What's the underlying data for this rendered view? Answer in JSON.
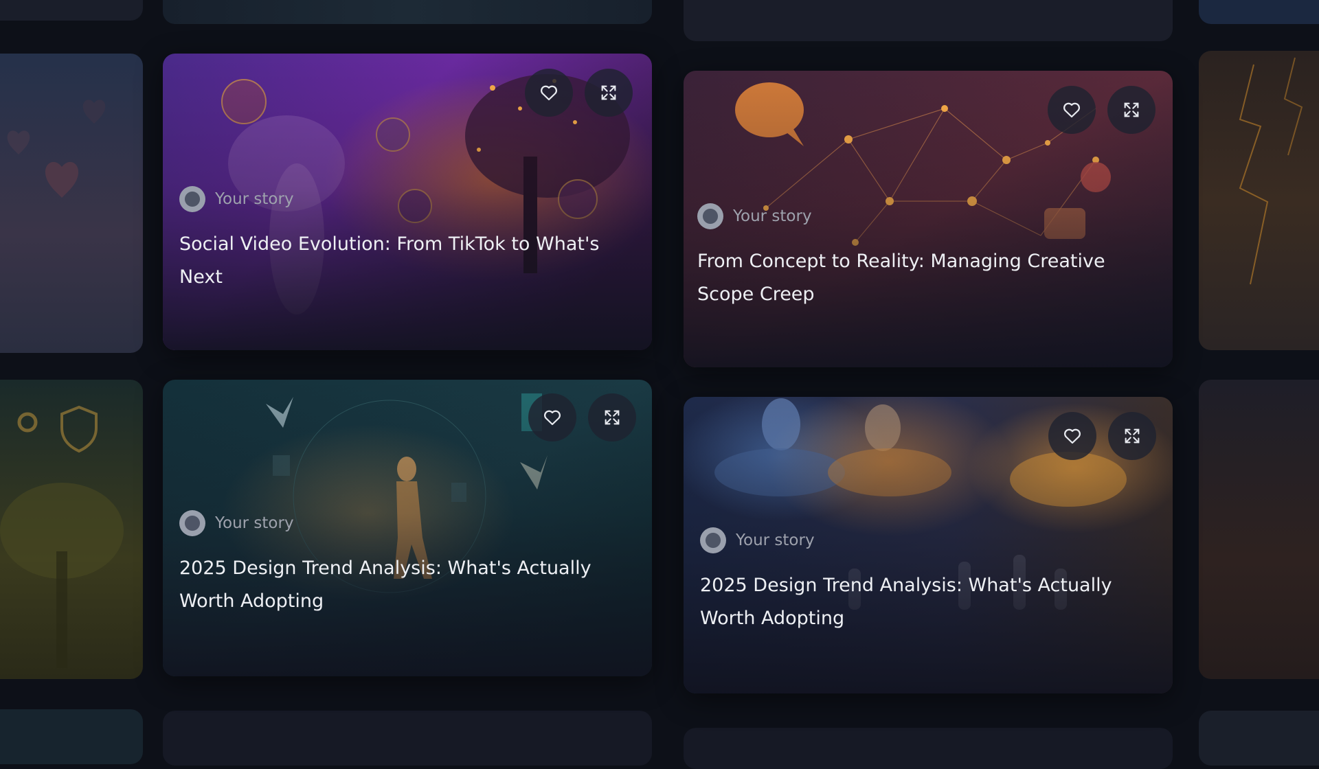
{
  "cards": [
    {
      "author": "Your story",
      "title": "Social Video Evolution: From TikTok to What's Next",
      "accent": "#7a3fbf"
    },
    {
      "author": "Your story",
      "title": "From Concept to Reality: Managing Creative Scope Creep",
      "accent": "#c86a2a"
    },
    {
      "author": "Your story",
      "title": "2025 Design Trend Analysis: What's Actually Worth Adopting",
      "accent": "#1f5a6a"
    },
    {
      "author": "Your story",
      "title": "2025 Design Trend Analysis: What's Actually Worth Adopting",
      "accent": "#2a4a8a"
    }
  ],
  "icons": {
    "like": "heart-icon",
    "expand": "expand-icon"
  }
}
